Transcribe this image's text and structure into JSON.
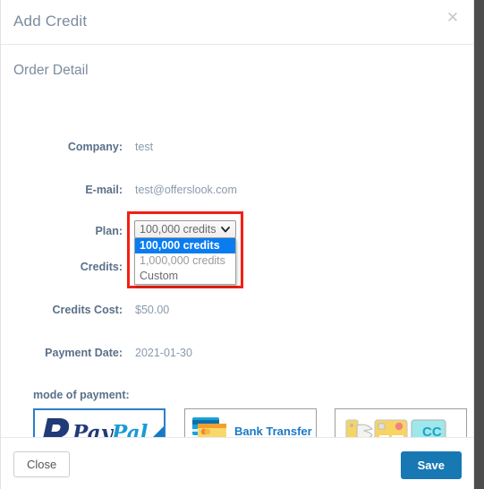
{
  "header": {
    "title": "Add Credit",
    "close_icon": "close-icon"
  },
  "body": {
    "section_title": "Order Detail",
    "fields": [
      {
        "label": "Company:",
        "value": "test"
      },
      {
        "label": "E-mail:",
        "value": "test@offerslook.com"
      },
      {
        "label": "Plan:",
        "value": ""
      },
      {
        "label": "Credits:",
        "value": ""
      },
      {
        "label": "Credits Cost:",
        "value": "$50.00"
      },
      {
        "label": "Payment Date:",
        "value": "2021-01-30"
      }
    ],
    "plan_select": {
      "selected_value": "100,000 credits",
      "expanded": true,
      "chevron_icon": "chevron-down-icon",
      "options": [
        {
          "label": "100,000 credits",
          "selected": true
        },
        {
          "label": "1,000,000 credits",
          "selected": false
        },
        {
          "label": "Custom",
          "selected": false
        }
      ]
    },
    "payment": {
      "label": "mode of payment:",
      "methods": [
        {
          "name": "paypal",
          "text": "PayPal",
          "selected": true
        },
        {
          "name": "bank-transfer",
          "text": "Bank Transfer",
          "selected": false
        },
        {
          "name": "credit-card",
          "text": "CC",
          "selected": false
        }
      ]
    }
  },
  "footer": {
    "close_label": "Close",
    "save_label": "Save"
  },
  "colors": {
    "accent_blue": "#1878b4",
    "highlight_blue": "#0a7cf0",
    "label_gray": "#5b7089",
    "value_gray": "#8a9aad",
    "title_gray": "#7b8ca0",
    "red_outline": "#f41f13"
  }
}
